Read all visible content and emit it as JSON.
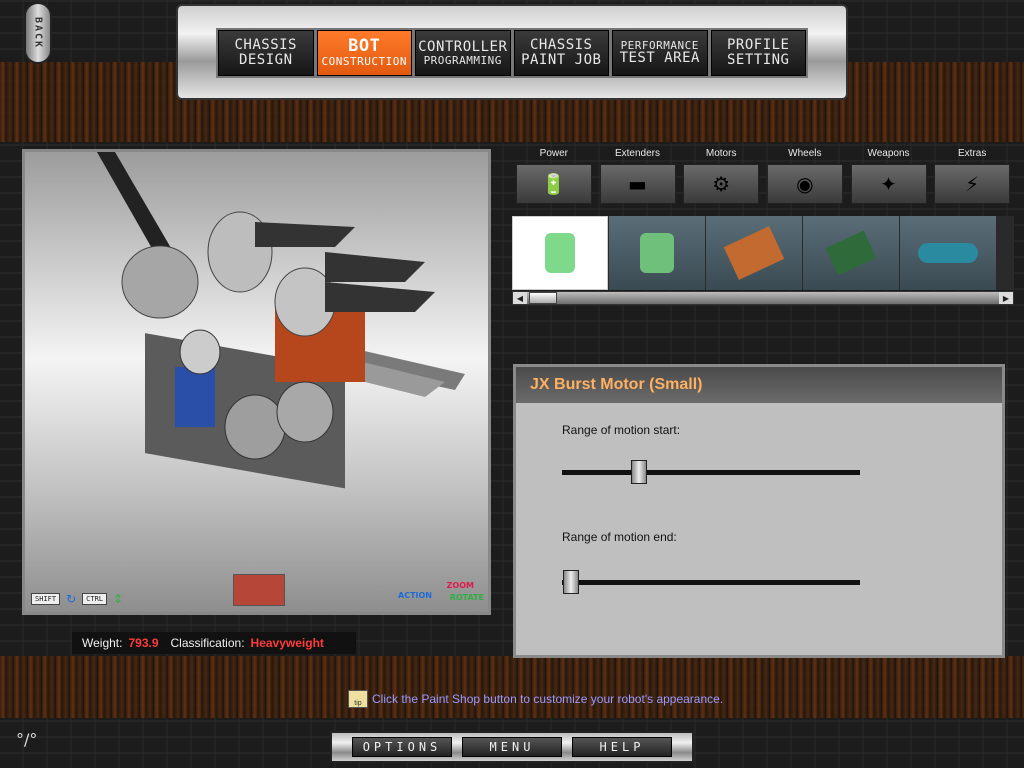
{
  "back": {
    "label": "BACK"
  },
  "nav": {
    "tabs": [
      {
        "l1": "CHASSIS",
        "l2": "DESIGN"
      },
      {
        "l1": "BOT",
        "l2": "CONSTRUCTION"
      },
      {
        "l1": "CONTROLLER",
        "l2": "PROGRAMMING"
      },
      {
        "l1": "CHASSIS",
        "l2": "PAINT JOB"
      },
      {
        "l1": "PERFORMANCE",
        "l2": "TEST AREA"
      },
      {
        "l1": "PROFILE",
        "l2": "SETTING"
      }
    ],
    "active": "BOT CONSTRUCTION"
  },
  "viewport": {
    "keys": {
      "shift": "SHIFT",
      "ctrl": "CTRL"
    },
    "labels": {
      "zoom": "ZOOM",
      "action": "ACTION",
      "rotate": "ROTATE"
    }
  },
  "stats": {
    "weight_label": "Weight:",
    "weight_value": "793.9",
    "class_label": "Classification:",
    "class_value": "Heavyweight"
  },
  "categories": [
    {
      "label": "Power",
      "icon": "battery-icon"
    },
    {
      "label": "Extenders",
      "icon": "extender-icon"
    },
    {
      "label": "Motors",
      "icon": "motor-icon"
    },
    {
      "label": "Wheels",
      "icon": "wheel-icon"
    },
    {
      "label": "Weapons",
      "icon": "weapon-icon"
    },
    {
      "label": "Extras",
      "icon": "extras-icon"
    }
  ],
  "parts": [
    {
      "icon": "green-motor-icon",
      "selected": true
    },
    {
      "icon": "green-motor-shaft-icon",
      "selected": false
    },
    {
      "icon": "orange-circuit-board-icon",
      "selected": false
    },
    {
      "icon": "green-circuit-board-icon",
      "selected": false
    },
    {
      "icon": "blue-cable-icon",
      "selected": false
    }
  ],
  "properties": {
    "title": "JX Burst Motor (Small)",
    "slider1": {
      "label": "Range of motion start:",
      "value": 0.26
    },
    "slider2": {
      "label": "Range of motion end:",
      "value": 0.03
    }
  },
  "tip": {
    "icon_text": "tip",
    "text": "Click the Paint Shop button to customize your robot's appearance."
  },
  "bottom": {
    "options": "OPTIONS",
    "menu": "MENU",
    "help": "HELP"
  },
  "colors": {
    "accent": "#ff6b1f",
    "stat_value": "#ff3b3b",
    "panel_title": "#ffb060",
    "tip_text": "#9a9aff"
  }
}
